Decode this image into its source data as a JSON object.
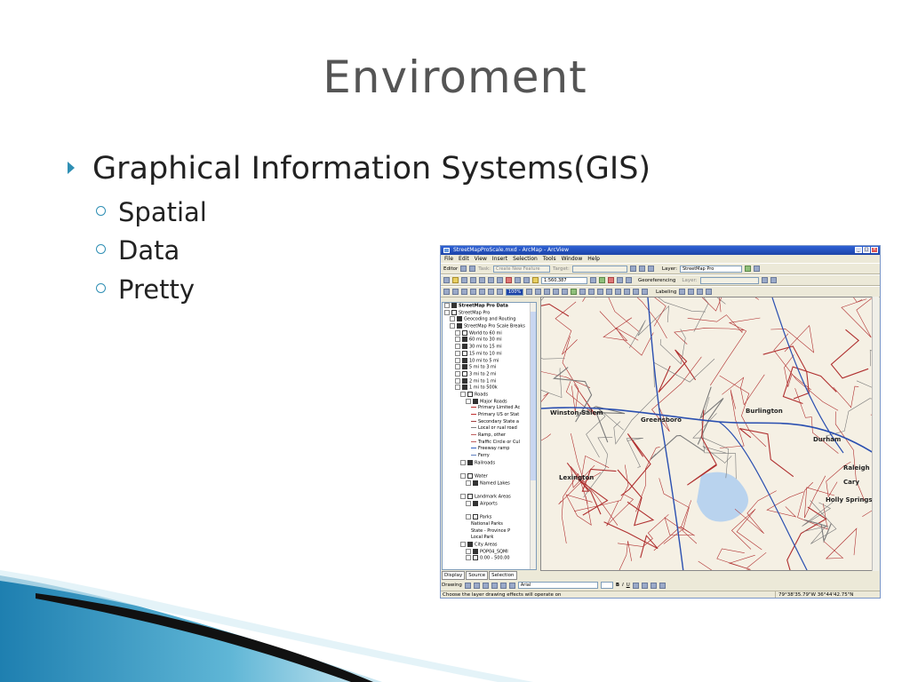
{
  "slide": {
    "title": "Enviroment",
    "bullet": "Graphical Information Systems(GIS)",
    "sub_bullets": [
      "Spatial",
      "Data",
      "Pretty"
    ],
    "accent_color": "#2f8fb4"
  },
  "arcmap": {
    "window_title": "StreetMapProScale.mxd - ArcMap - ArcView",
    "menu": [
      "File",
      "Edit",
      "View",
      "Insert",
      "Selection",
      "Tools",
      "Window",
      "Help"
    ],
    "editor_label": "Editor",
    "task_value": "Create New Feature",
    "target_label": "Target:",
    "layer_label": "Layer:",
    "layer_value": "StreetMap Pro",
    "scale_value": "1:560,387",
    "georeferencing_label": "Georeferencing",
    "georef_layer_label": "Layer:",
    "zoom_value": "100%",
    "labeling_label": "Labeling",
    "toc_items": [
      {
        "text": "StreetMap Pro Data",
        "level": 0,
        "bold": true
      },
      {
        "text": "StreetMap Pro",
        "level": 0
      },
      {
        "text": "Geocoding and Routing",
        "level": 1
      },
      {
        "text": "StreetMap Pro Scale Breaks",
        "level": 1
      },
      {
        "text": "World to 60 mi",
        "level": 2
      },
      {
        "text": "60 mi to 30 mi",
        "level": 2
      },
      {
        "text": "30 mi to 15 mi",
        "level": 2
      },
      {
        "text": "15 mi to 10 mi",
        "level": 2
      },
      {
        "text": "10 mi to 5 mi",
        "level": 2
      },
      {
        "text": "5 mi to 3 mi",
        "level": 2
      },
      {
        "text": "3 mi to 2 mi",
        "level": 2
      },
      {
        "text": "2 mi to 1 mi",
        "level": 2
      },
      {
        "text": "1 mi to 500k",
        "level": 2
      },
      {
        "text": "Roads",
        "level": 3
      },
      {
        "text": "Major Roads",
        "level": 4
      },
      {
        "text": "Primary Limited Ac",
        "level": 5,
        "swatch": "#c03030"
      },
      {
        "text": "Primary US or Stat",
        "level": 5,
        "swatch": "#c03030"
      },
      {
        "text": "Secondary State a",
        "level": 5,
        "swatch": "#a04040"
      },
      {
        "text": "Local or rual road",
        "level": 5,
        "swatch": "#808080"
      },
      {
        "text": "Ramp, other",
        "level": 5,
        "swatch": "#c06060"
      },
      {
        "text": "Traffic Circle or Cul",
        "level": 5,
        "swatch": "#c06060"
      },
      {
        "text": "Freeway ramp",
        "level": 5,
        "swatch": "#3060c0"
      },
      {
        "text": "Ferry",
        "level": 5,
        "swatch": "#6080c0"
      },
      {
        "text": "Railroads",
        "level": 3
      },
      {
        "text": "",
        "level": 4
      },
      {
        "text": "Water",
        "level": 3
      },
      {
        "text": "Named Lakes",
        "level": 4
      },
      {
        "text": "",
        "level": 4
      },
      {
        "text": "Landmark Areas",
        "level": 3
      },
      {
        "text": "Airports",
        "level": 4
      },
      {
        "text": "",
        "level": 4
      },
      {
        "text": "Parks",
        "level": 4
      },
      {
        "text": "National Parks",
        "level": 5
      },
      {
        "text": "State - Province P",
        "level": 5
      },
      {
        "text": "Local Park",
        "level": 5
      },
      {
        "text": "City Areas",
        "level": 3
      },
      {
        "text": "POP04_SQMI",
        "level": 4
      },
      {
        "text": "0.00 - 500.00",
        "level": 4
      }
    ],
    "toc_tabs": [
      "Display",
      "Source",
      "Selection"
    ],
    "drawing_label": "Drawing",
    "font_value": "Arial",
    "status_message": "Choose the layer drawing effects will operate on",
    "status_coords": "79°38'35.79\"W  36°44'42.75\"N",
    "map_labels": [
      "Winston-Salem",
      "Greensboro",
      "Durham",
      "Raleigh",
      "Cary",
      "Lexington",
      "Burlington",
      "Holly Springs"
    ]
  }
}
